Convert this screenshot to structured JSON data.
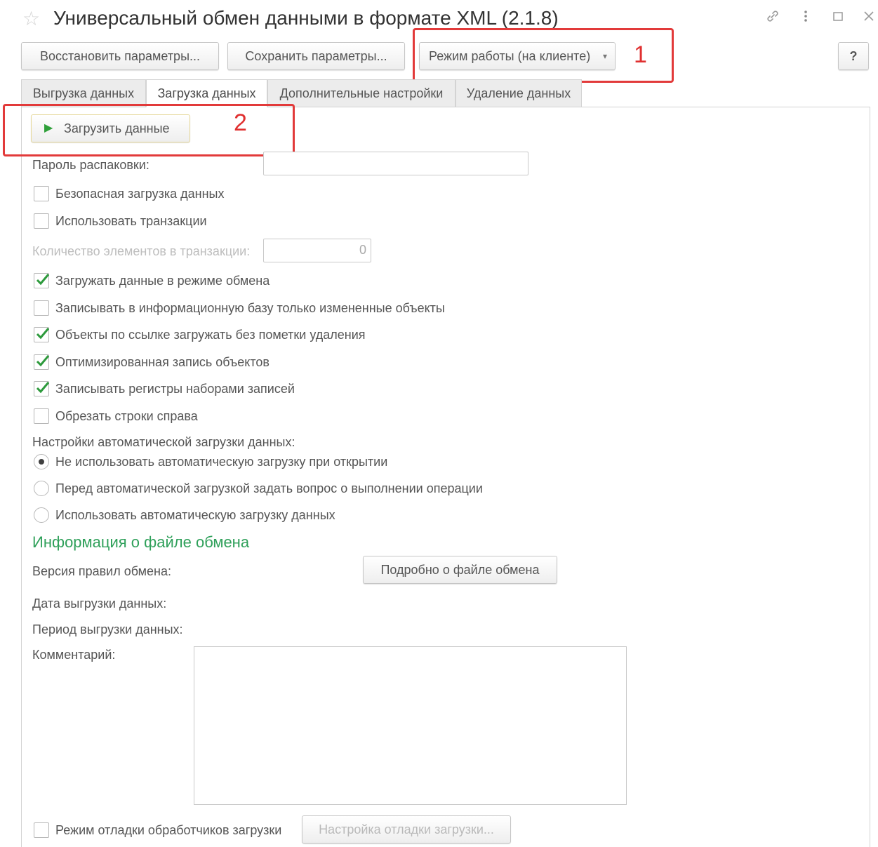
{
  "window": {
    "title": "Универсальный обмен данными в формате XML (2.1.8)",
    "icons": [
      "star-icon",
      "link-icon",
      "more-icon",
      "maximize-icon",
      "close-icon"
    ]
  },
  "toolbar": {
    "restore_label": "Восстановить параметры...",
    "save_label": "Сохранить параметры...",
    "mode_label": "Режим работы (на клиенте)",
    "help_label": "?"
  },
  "tabs": [
    {
      "label": "Выгрузка данных",
      "active": false
    },
    {
      "label": "Загрузка данных",
      "active": true
    },
    {
      "label": "Дополнительные настройки",
      "active": false
    },
    {
      "label": "Удаление данных",
      "active": false
    }
  ],
  "annotations": {
    "n1": "1",
    "n2": "2",
    "color": "#e23a3a"
  },
  "load": {
    "button_label": "Загрузить данные",
    "password_label": "Пароль распаковки:",
    "password_value": "",
    "safe_load": {
      "label": "Безопасная загрузка данных",
      "checked": false
    },
    "use_transactions": {
      "label": "Использовать транзакции",
      "checked": false
    },
    "tx_count_label": "Количество элементов в транзакции:",
    "tx_count_value": "0",
    "checkboxes": [
      {
        "label": "Загружать данные в режиме обмена",
        "checked": true
      },
      {
        "label": "Записывать в информационную базу только измененные объекты",
        "checked": false
      },
      {
        "label": "Объекты по ссылке загружать без пометки удаления",
        "checked": true
      },
      {
        "label": "Оптимизированная запись объектов",
        "checked": true
      },
      {
        "label": "Записывать регистры наборами записей",
        "checked": true
      },
      {
        "label": "Обрезать строки справа",
        "checked": false
      }
    ],
    "auto_label": "Настройки автоматической загрузки данных:",
    "radios": [
      {
        "label": "Не использовать автоматическую загрузку при открытии",
        "selected": true
      },
      {
        "label": "Перед автоматической загрузкой задать вопрос о выполнении операции",
        "selected": false
      },
      {
        "label": "Использовать автоматическую загрузку данных",
        "selected": false
      }
    ]
  },
  "info": {
    "section_title": "Информация о файле обмена",
    "accent": "#2fa05a",
    "rules_version_label": "Версия правил обмена:",
    "details_button": "Подробно о файле обмена",
    "export_date_label": "Дата выгрузки данных:",
    "export_period_label": "Период выгрузки данных:",
    "comment_label": "Комментарий:",
    "comment_value": ""
  },
  "debug": {
    "label": "Режим отладки обработчиков загрузки",
    "checked": false,
    "button_label": "Настройка отладки загрузки..."
  }
}
